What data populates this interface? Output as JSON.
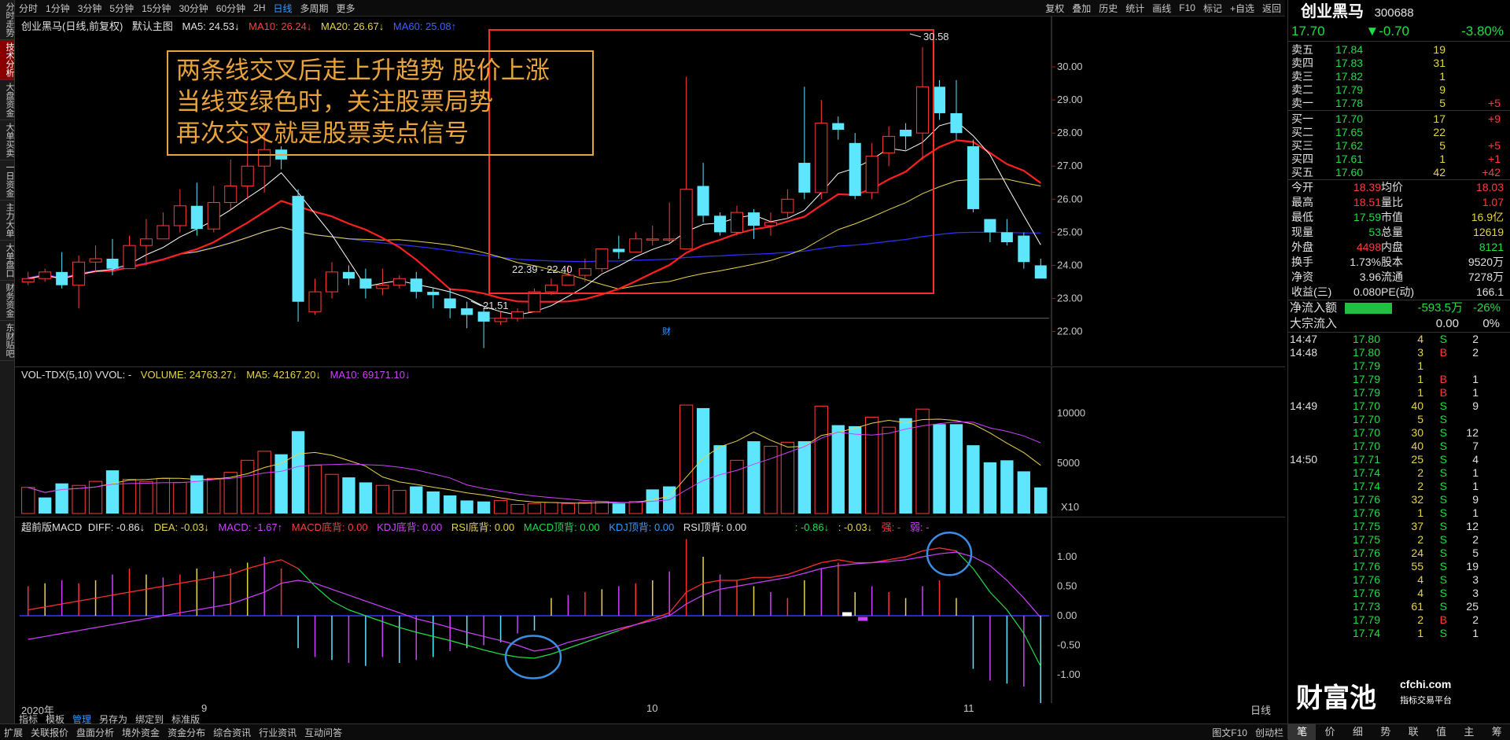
{
  "left_nav": [
    "分时走势",
    "技术分析",
    "大盘资金",
    "大单买卖",
    "一日资金",
    "主力大单",
    "大单盘口",
    "财务资金",
    "东财贴吧"
  ],
  "top_bar": {
    "stock_short": "创业黑马",
    "periods": [
      "分时",
      "1分钟",
      "3分钟",
      "5分钟",
      "15分钟",
      "30分钟",
      "60分钟",
      "2H",
      "日线",
      "多周期",
      "更多"
    ],
    "active_period": "日线",
    "tools": [
      "复权",
      "叠加",
      "历史",
      "统计",
      "画线",
      "F10",
      "标记",
      "+自选",
      "返回"
    ]
  },
  "main_chart": {
    "title": "创业黑马(日线,前复权)",
    "template": "默认主图",
    "ma5": "MA5: 24.53↓",
    "ma10": "MA10: 26.24↓",
    "ma20": "MA20: 26.67↓",
    "ma60": "MA60: 25.08↑",
    "y_ticks": [
      "30.00",
      "29.00",
      "28.00",
      "27.00",
      "26.00",
      "25.00",
      "24.00",
      "23.00",
      "22.00"
    ],
    "high_label": "30.58",
    "low_label": "21.51",
    "range_label": "22.39 - 22.40",
    "finance_mark": "财",
    "annotation": [
      "两条线交叉后走上升趋势    股价上涨",
      "当线变绿色时，关注股票局势",
      "再次交叉就是股票卖点信号"
    ]
  },
  "vol_chart": {
    "title": "VOL-TDX(5,10) VVOL: -",
    "volume": "VOLUME: 24763.27↓",
    "ma5": "MA5: 42167.20↓",
    "ma10": "MA10: 69171.10↓",
    "y_ticks": [
      "10000",
      "5000"
    ],
    "unit": "X10"
  },
  "macd_chart": {
    "title": "超前版MACD",
    "diff": "DIFF: -0.86↓",
    "dea": "DEA: -0.03↓",
    "macd": "MACD: -1.67↑",
    "items": [
      "MACD底背: 0.00",
      "KDJ底背: 0.00",
      "RSI底背: 0.00",
      "MACD顶背: 0.00",
      "KDJ顶背: 0.00",
      "RSI顶背: 0.00"
    ],
    "tail": [
      ": -0.86↓",
      ": -0.03↓",
      "强: -",
      "弱: -"
    ],
    "y_ticks": [
      "1.00",
      "0.50",
      "0.00",
      "-0.50",
      "-1.00"
    ]
  },
  "x_axis": {
    "year": "2020年",
    "months": [
      "9",
      "10",
      "11"
    ],
    "right_label": "日线"
  },
  "bottom_bar": [
    "指标",
    "模板",
    "管理",
    "另存为",
    "绑定到",
    "标准版"
  ],
  "status_bar": [
    "扩展",
    "关联报价",
    "盘面分析",
    "境外资金",
    "资金分布",
    "综合资讯",
    "行业资讯",
    "互动问答"
  ],
  "status_right": [
    "图文F10",
    "创动栏"
  ],
  "quote": {
    "name": "创业黑马",
    "code": "300688",
    "price": "17.70",
    "change": "▼-0.70",
    "pct": "-3.80%",
    "asks": [
      {
        "label": "卖五",
        "price": "17.84",
        "vol": "19",
        "chg": ""
      },
      {
        "label": "卖四",
        "price": "17.83",
        "vol": "31",
        "chg": ""
      },
      {
        "label": "卖三",
        "price": "17.82",
        "vol": "1",
        "chg": ""
      },
      {
        "label": "卖二",
        "price": "17.79",
        "vol": "9",
        "chg": ""
      },
      {
        "label": "卖一",
        "price": "17.78",
        "vol": "5",
        "chg": "+5"
      }
    ],
    "bids": [
      {
        "label": "买一",
        "price": "17.70",
        "vol": "17",
        "chg": "+9"
      },
      {
        "label": "买二",
        "price": "17.65",
        "vol": "22",
        "chg": ""
      },
      {
        "label": "买三",
        "price": "17.62",
        "vol": "5",
        "chg": "+5"
      },
      {
        "label": "买四",
        "price": "17.61",
        "vol": "1",
        "chg": "+1"
      },
      {
        "label": "买五",
        "price": "17.60",
        "vol": "42",
        "chg": "+42"
      }
    ],
    "stats": [
      [
        "今开",
        "18.39",
        "均价",
        "18.03"
      ],
      [
        "最高",
        "18.51",
        "量比",
        "1.07"
      ],
      [
        "最低",
        "17.59",
        "市值",
        "16.9亿"
      ],
      [
        "现量",
        "53",
        "总量",
        "12619"
      ],
      [
        "外盘",
        "4498",
        "内盘",
        "8121"
      ],
      [
        "换手",
        "1.73%",
        "股本",
        "9520万"
      ],
      [
        "净资",
        "3.96",
        "流通",
        "7278万"
      ],
      [
        "收益(三)",
        "0.080",
        "PE(动)",
        "166.1"
      ]
    ],
    "net_flow_label": "净流入额",
    "net_flow": "-593.5万",
    "net_flow_pct": "-26%",
    "block_label": "大宗流入",
    "block_val": "0.00",
    "block_pct": "0%"
  },
  "ticks": [
    [
      "14:47",
      "17.80",
      "4",
      "S",
      "2"
    ],
    [
      "14:48",
      "17.80",
      "3",
      "B",
      "2"
    ],
    [
      "",
      "17.79",
      "1",
      "",
      ""
    ],
    [
      "",
      "17.79",
      "1",
      "B",
      "1"
    ],
    [
      "",
      "17.79",
      "1",
      "B",
      "1"
    ],
    [
      "14:49",
      "17.70",
      "40",
      "S",
      "9"
    ],
    [
      "",
      "17.70",
      "5",
      "S",
      ""
    ],
    [
      "",
      "17.70",
      "30",
      "S",
      "12"
    ],
    [
      "",
      "17.70",
      "40",
      "S",
      "7"
    ],
    [
      "14:50",
      "17.71",
      "25",
      "S",
      "4"
    ],
    [
      "",
      "17.74",
      "2",
      "S",
      "1"
    ],
    [
      "",
      "17.74",
      "2",
      "S",
      "1"
    ],
    [
      "",
      "17.76",
      "32",
      "S",
      "9"
    ],
    [
      "",
      "17.76",
      "1",
      "S",
      "1"
    ],
    [
      "",
      "17.75",
      "37",
      "S",
      "12"
    ],
    [
      "",
      "17.75",
      "2",
      "S",
      "2"
    ],
    [
      "",
      "17.76",
      "24",
      "S",
      "5"
    ],
    [
      "",
      "17.76",
      "55",
      "S",
      "19"
    ],
    [
      "",
      "17.76",
      "4",
      "S",
      "3"
    ],
    [
      "",
      "17.76",
      "4",
      "S",
      "3"
    ],
    [
      "",
      "17.73",
      "61",
      "S",
      "25"
    ],
    [
      "",
      "17.79",
      "2",
      "B",
      "2"
    ],
    [
      "",
      "17.74",
      "1",
      "S",
      "1"
    ]
  ],
  "bottom_tabs": [
    "笔",
    "价",
    "细",
    "势",
    "联",
    "值",
    "主",
    "筹"
  ],
  "watermark": {
    "brand": "财富池",
    "site": "cfchi.com",
    "tagline": "指标交易平台"
  },
  "colors": {
    "up": "#ff3b3b",
    "down": "#5fe6ff",
    "ma5": "#ffffff",
    "ma10": "#ff2020",
    "ma20": "#e6d34a",
    "ma60": "#3030ff",
    "annotation": "#e8a33a",
    "highlight_box": "#ff2a2a",
    "circle": "#3a8ee6"
  },
  "chart_data": [
    {
      "type": "candlestick",
      "title": "创业黑马(日线,前复权)",
      "ylim": [
        21.3,
        31.0
      ],
      "candles": [
        [
          23.5,
          23.6,
          23.4,
          23.8
        ],
        [
          23.6,
          23.8,
          23.5,
          23.9
        ],
        [
          23.8,
          23.4,
          23.3,
          24.4
        ],
        [
          23.4,
          24.1,
          22.7,
          24.3
        ],
        [
          24.1,
          24.2,
          23.8,
          24.6
        ],
        [
          24.2,
          23.9,
          23.7,
          24.8
        ],
        [
          23.9,
          24.6,
          23.9,
          24.9
        ],
        [
          24.6,
          24.8,
          24.0,
          25.4
        ],
        [
          24.8,
          25.2,
          24.8,
          25.6
        ],
        [
          25.2,
          25.8,
          25.0,
          26.3
        ],
        [
          25.8,
          25.1,
          24.9,
          26.5
        ],
        [
          25.1,
          25.9,
          25.0,
          26.4
        ],
        [
          25.9,
          26.4,
          25.7,
          27.2
        ],
        [
          26.4,
          27.0,
          26.0,
          27.9
        ],
        [
          27.0,
          27.5,
          26.2,
          28.3
        ],
        [
          27.5,
          27.2,
          26.9,
          27.6
        ],
        [
          26.1,
          22.9,
          22.3,
          26.3
        ],
        [
          22.6,
          23.2,
          22.5,
          23.6
        ],
        [
          23.2,
          23.8,
          23.0,
          24.1
        ],
        [
          23.8,
          23.6,
          23.4,
          24.0
        ],
        [
          23.6,
          23.3,
          23.0,
          23.9
        ],
        [
          23.3,
          23.4,
          23.1,
          23.9
        ],
        [
          23.4,
          23.6,
          23.3,
          23.7
        ],
        [
          23.6,
          23.2,
          23.0,
          23.8
        ],
        [
          23.2,
          23.1,
          22.7,
          23.3
        ],
        [
          23.0,
          22.7,
          22.4,
          23.3
        ],
        [
          22.7,
          22.5,
          22.1,
          22.9
        ],
        [
          22.6,
          22.3,
          21.5,
          22.7
        ],
        [
          22.3,
          22.4,
          22.2,
          22.6
        ],
        [
          22.4,
          22.6,
          22.3,
          22.7
        ],
        [
          22.6,
          23.2,
          22.6,
          23.3
        ],
        [
          23.2,
          23.4,
          23.1,
          23.6
        ],
        [
          23.4,
          23.7,
          23.4,
          24.0
        ],
        [
          23.7,
          23.9,
          23.5,
          24.2
        ],
        [
          23.9,
          24.5,
          23.8,
          24.5
        ],
        [
          24.5,
          24.4,
          24.2,
          24.9
        ],
        [
          24.4,
          24.8,
          24.4,
          25.0
        ],
        [
          24.8,
          24.8,
          24.6,
          25.2
        ],
        [
          24.8,
          24.8,
          24.7,
          25.9
        ],
        [
          24.5,
          26.3,
          24.5,
          29.7
        ],
        [
          26.4,
          25.5,
          25.3,
          27.1
        ],
        [
          25.5,
          25.0,
          24.9,
          25.6
        ],
        [
          25.0,
          25.6,
          24.9,
          25.8
        ],
        [
          25.6,
          25.2,
          24.8,
          25.7
        ],
        [
          25.2,
          25.3,
          24.9,
          25.6
        ],
        [
          25.6,
          26.0,
          25.4,
          26.3
        ],
        [
          27.1,
          26.2,
          26.0,
          29.4
        ],
        [
          26.2,
          28.3,
          26.0,
          29.0
        ],
        [
          28.3,
          28.1,
          27.8,
          28.5
        ],
        [
          27.7,
          26.1,
          26.0,
          28.0
        ],
        [
          26.2,
          27.3,
          26.0,
          27.7
        ],
        [
          27.4,
          27.9,
          27.0,
          28.2
        ],
        [
          28.1,
          27.9,
          27.5,
          28.3
        ],
        [
          28.0,
          29.4,
          27.2,
          30.6
        ],
        [
          29.4,
          28.6,
          28.4,
          29.6
        ],
        [
          28.6,
          28.0,
          27.8,
          29.6
        ],
        [
          27.6,
          25.7,
          25.6,
          27.8
        ],
        [
          25.4,
          25.0,
          24.7,
          25.4
        ],
        [
          25.0,
          24.7,
          24.6,
          25.4
        ],
        [
          24.9,
          24.1,
          23.9,
          25.0
        ],
        [
          24.0,
          23.6,
          23.6,
          24.2
        ]
      ]
    },
    {
      "type": "bar",
      "title": "VOL-TDX(5,10)",
      "ylim": [
        0,
        13000
      ],
      "values": [
        2600,
        1600,
        3000,
        2800,
        3200,
        4300,
        3400,
        3200,
        3500,
        3100,
        3800,
        3500,
        4100,
        5300,
        6200,
        5900,
        8200,
        4800,
        3900,
        3600,
        3100,
        2800,
        2300,
        2700,
        2200,
        1800,
        1300,
        1200,
        1300,
        900,
        1000,
        1100,
        1000,
        1100,
        1200,
        1000,
        1200,
        2400,
        2700,
        10800,
        10500,
        6800,
        5300,
        7200,
        6700,
        7100,
        7200,
        10700,
        8800,
        8700,
        9600,
        8600,
        9500,
        10400,
        8900,
        8900,
        6800,
        5100,
        5300,
        4200,
        2600
      ],
      "up": [
        true,
        false,
        false,
        true,
        true,
        false,
        true,
        true,
        true,
        true,
        false,
        true,
        true,
        true,
        true,
        false,
        false,
        true,
        true,
        false,
        false,
        true,
        true,
        false,
        false,
        false,
        false,
        false,
        true,
        true,
        true,
        true,
        true,
        true,
        true,
        false,
        true,
        false,
        false,
        true,
        false,
        false,
        true,
        false,
        true,
        true,
        false,
        true,
        false,
        false,
        true,
        true,
        false,
        true,
        false,
        false,
        false,
        false,
        false,
        false,
        false
      ]
    },
    {
      "type": "line",
      "title": "超前版MACD",
      "ylim": [
        -1.4,
        1.4
      ],
      "series": [
        {
          "name": "DIFF",
          "values": [
            0.1,
            0.15,
            0.2,
            0.25,
            0.3,
            0.35,
            0.4,
            0.45,
            0.5,
            0.55,
            0.6,
            0.65,
            0.7,
            0.8,
            0.88,
            0.95,
            0.8,
            0.5,
            0.25,
            0.1,
            0.0,
            -0.1,
            -0.2,
            -0.28,
            -0.35,
            -0.42,
            -0.5,
            -0.58,
            -0.65,
            -0.7,
            -0.72,
            -0.65,
            -0.55,
            -0.45,
            -0.35,
            -0.25,
            -0.15,
            -0.05,
            0.05,
            0.4,
            0.55,
            0.6,
            0.6,
            0.65,
            0.65,
            0.7,
            0.8,
            0.9,
            0.95,
            0.9,
            0.9,
            0.95,
            1.0,
            1.1,
            1.15,
            1.1,
            0.8,
            0.4,
            0.1,
            -0.3,
            -0.86
          ]
        },
        {
          "name": "DEA",
          "values": [
            -0.4,
            -0.35,
            -0.3,
            -0.25,
            -0.2,
            -0.15,
            -0.1,
            -0.05,
            0.0,
            0.05,
            0.1,
            0.15,
            0.2,
            0.3,
            0.4,
            0.55,
            0.6,
            0.55,
            0.45,
            0.35,
            0.25,
            0.15,
            0.05,
            -0.05,
            -0.12,
            -0.2,
            -0.28,
            -0.35,
            -0.42,
            -0.5,
            -0.6,
            -0.55,
            -0.45,
            -0.38,
            -0.3,
            -0.22,
            -0.15,
            -0.08,
            0.0,
            0.2,
            0.35,
            0.45,
            0.5,
            0.55,
            0.6,
            0.65,
            0.72,
            0.8,
            0.85,
            0.88,
            0.9,
            0.92,
            0.95,
            1.0,
            1.05,
            1.08,
            1.0,
            0.85,
            0.6,
            0.3,
            -0.03
          ]
        }
      ],
      "bars": [
        0.5,
        0.55,
        0.6,
        0.55,
        0.6,
        0.7,
        0.8,
        0.7,
        0.65,
        0.7,
        0.8,
        0.75,
        0.8,
        0.9,
        1.0,
        0.8,
        -0.55,
        -0.7,
        -0.75,
        -0.8,
        -0.85,
        -0.7,
        -0.8,
        -0.75,
        -0.7,
        -0.6,
        -0.55,
        -0.5,
        -0.45,
        -0.3,
        -0.25,
        0.3,
        0.35,
        0.4,
        0.45,
        0.5,
        0.55,
        0.6,
        0.75,
        1.3,
        1.0,
        0.7,
        0.6,
        0.5,
        0.4,
        0.3,
        0.6,
        0.8,
        0.9,
        0.4,
        0.5,
        0.4,
        0.3,
        0.5,
        0.6,
        0.3,
        -0.9,
        -1.1,
        -1.15,
        -1.2,
        -1.67
      ]
    }
  ]
}
